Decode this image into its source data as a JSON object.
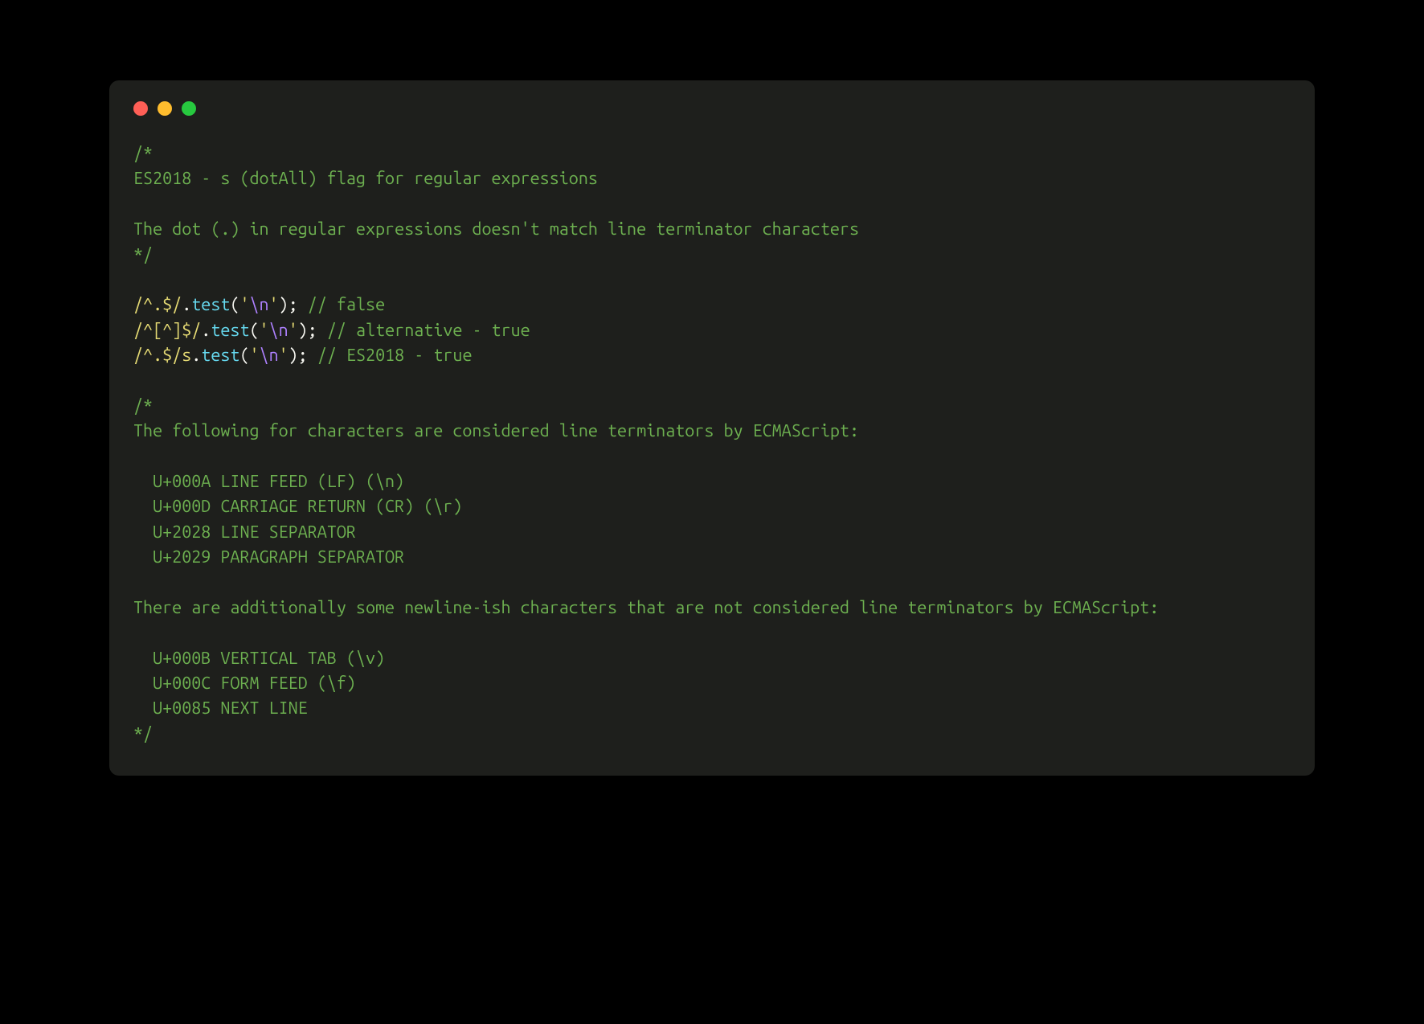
{
  "comment1": "/*\nES2018 - s (dotAll) flag for regular expressions\n\nThe dot (.) in regular expressions doesn't match line terminator characters\n*/",
  "line1": {
    "regex": "/^.$/",
    "dot": ".",
    "method": "test",
    "p_open": "(",
    "sq1": "'",
    "esc": "\\n",
    "sq2": "'",
    "p_close": ");",
    "space": " ",
    "comment": "// false"
  },
  "line2": {
    "regex": "/^[^]$/",
    "dot": ".",
    "method": "test",
    "p_open": "(",
    "sq1": "'",
    "esc": "\\n",
    "sq2": "'",
    "p_close": ");",
    "space": " ",
    "comment": "// alternative - true"
  },
  "line3": {
    "regex": "/^.$/s",
    "dot": ".",
    "method": "test",
    "p_open": "(",
    "sq1": "'",
    "esc": "\\n",
    "sq2": "'",
    "p_close": ");",
    "space": " ",
    "comment": "// ES2018 - true"
  },
  "comment2": "/*\nThe following for characters are considered line terminators by ECMAScript:\n\n  U+000A LINE FEED (LF) (\\n)\n  U+000D CARRIAGE RETURN (CR) (\\r)\n  U+2028 LINE SEPARATOR\n  U+2029 PARAGRAPH SEPARATOR\n\nThere are additionally some newline-ish characters that are not considered line terminators by ECMAScript:\n\n  U+000B VERTICAL TAB (\\v)\n  U+000C FORM FEED (\\f)\n  U+0085 NEXT LINE\n*/"
}
